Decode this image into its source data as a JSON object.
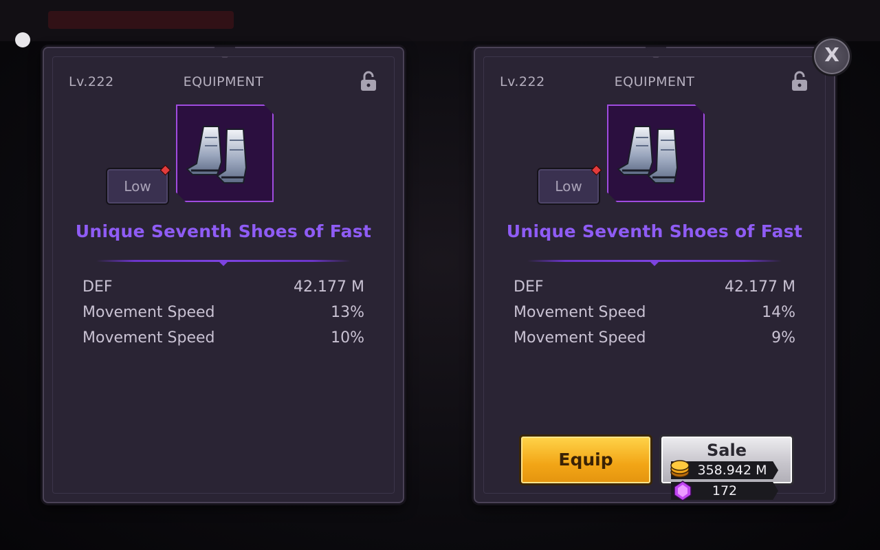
{
  "colors": {
    "panel_bg": "#2a2434",
    "item_name": "#8f5cf5",
    "equip_button": "#f2a516",
    "sale_button": "#c8c6cd",
    "grade_badge": "#3a3150"
  },
  "left_panel": {
    "level": "Lv.222",
    "category": "EQUIPMENT",
    "lock_icon": "unlocked-padlock",
    "grade": "Low",
    "item_icon": "armored-boots",
    "item_name": "Unique Seventh Shoes of Fast",
    "stats": [
      {
        "label": "DEF",
        "value": "42.177 M"
      },
      {
        "label": "Movement Speed",
        "value": "13%"
      },
      {
        "label": "Movement Speed",
        "value": "10%"
      }
    ]
  },
  "right_panel": {
    "level": "Lv.222",
    "category": "EQUIPMENT",
    "lock_icon": "unlocked-padlock",
    "grade": "Low",
    "item_icon": "armored-boots",
    "item_name": "Unique Seventh Shoes of Fast",
    "stats": [
      {
        "label": "DEF",
        "value": "42.177 M"
      },
      {
        "label": "Movement Speed",
        "value": "14%"
      },
      {
        "label": "Movement Speed",
        "value": "9%"
      }
    ],
    "equip_label": "Equip",
    "sale_label": "Sale",
    "sale_gold": "358.942 M",
    "sale_gems": "172"
  },
  "close_label": "X"
}
